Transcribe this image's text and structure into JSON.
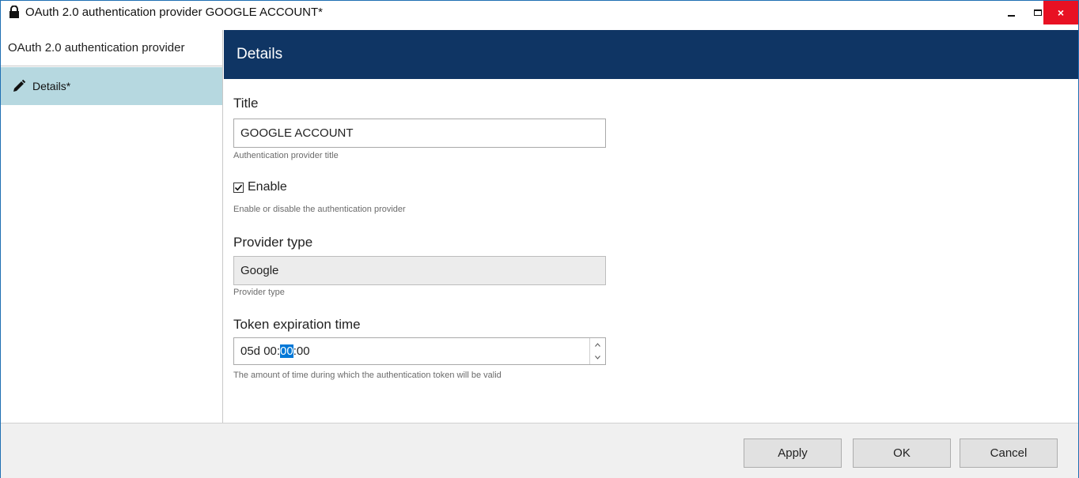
{
  "window": {
    "title": "OAuth 2.0 authentication provider GOOGLE ACCOUNT*",
    "close_glyph": "×"
  },
  "sidebar": {
    "header": "OAuth 2.0 authentication provider",
    "items": [
      {
        "label": "Details*",
        "icon": "pencil-icon",
        "selected": true
      }
    ]
  },
  "main": {
    "header": "Details",
    "fields": {
      "title": {
        "label": "Title",
        "value": "GOOGLE ACCOUNT",
        "hint": "Authentication provider title"
      },
      "enable": {
        "label": "Enable",
        "checked": true,
        "hint": "Enable or disable the authentication provider"
      },
      "provider_type": {
        "label": "Provider type",
        "value": "Google",
        "hint": "Provider type"
      },
      "token_expiration": {
        "label": "Token expiration time",
        "value_before": "05d 00:",
        "value_selected": "00",
        "value_after": ":00",
        "hint": "The amount of time during which the authentication token will be valid"
      }
    }
  },
  "footer": {
    "apply_label": "Apply",
    "ok_label": "OK",
    "cancel_label": "Cancel"
  },
  "colors": {
    "header_bg": "#0f3564",
    "selected_item_bg": "#b6d8e0",
    "close_bg": "#e81123",
    "selection": "#0078d7"
  }
}
